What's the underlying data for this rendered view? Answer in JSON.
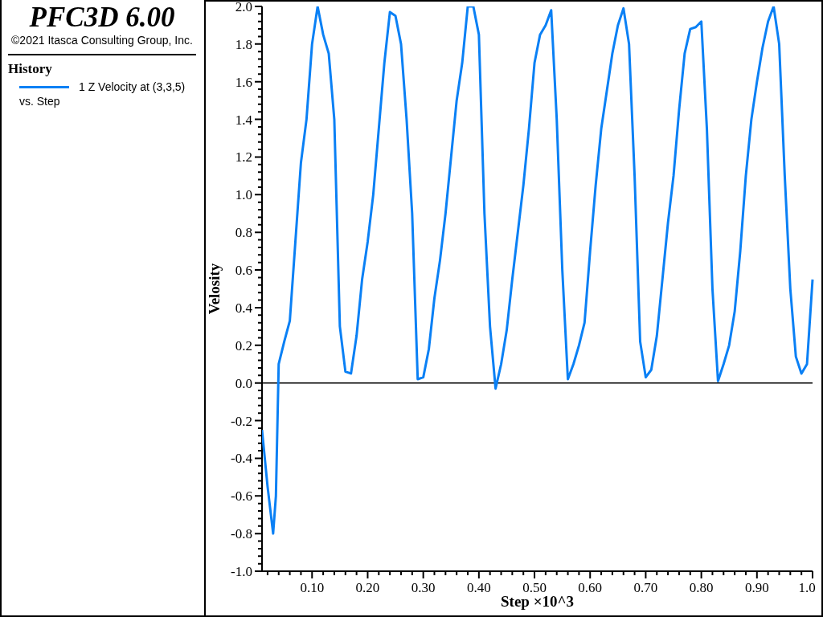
{
  "header": {
    "title": "PFC3D 6.00",
    "copyright": "©2021 Itasca Consulting Group, Inc."
  },
  "legend": {
    "heading": "History",
    "footer": "vs. Step"
  },
  "plot": {
    "chart_data": {
      "type": "line",
      "xlabel": "Step ×10^3",
      "ylabel": "Velosity",
      "xlim": [
        0.01,
        1.0
      ],
      "ylim": [
        -1.0,
        2.0
      ],
      "xticks": [
        {
          "value": 0.1,
          "label": "0.10"
        },
        {
          "value": 0.2,
          "label": "0.20"
        },
        {
          "value": 0.3,
          "label": "0.30"
        },
        {
          "value": 0.4,
          "label": "0.40"
        },
        {
          "value": 0.5,
          "label": "0.50"
        },
        {
          "value": 0.6,
          "label": "0.60"
        },
        {
          "value": 0.7,
          "label": "0.70"
        },
        {
          "value": 0.8,
          "label": "0.80"
        },
        {
          "value": 0.9,
          "label": "0.90"
        },
        {
          "value": 1.0,
          "label": "1.0"
        }
      ],
      "yticks": [
        {
          "value": -1.0,
          "label": "-1.0"
        },
        {
          "value": -0.8,
          "label": "-0.8"
        },
        {
          "value": -0.6,
          "label": "-0.6"
        },
        {
          "value": -0.4,
          "label": "-0.4"
        },
        {
          "value": -0.2,
          "label": "-0.2"
        },
        {
          "value": 0.0,
          "label": "0.0"
        },
        {
          "value": 0.2,
          "label": "0.2"
        },
        {
          "value": 0.4,
          "label": "0.4"
        },
        {
          "value": 0.6,
          "label": "0.6"
        },
        {
          "value": 0.8,
          "label": "0.8"
        },
        {
          "value": 1.0,
          "label": "1.0"
        },
        {
          "value": 1.2,
          "label": "1.2"
        },
        {
          "value": 1.4,
          "label": "1.4"
        },
        {
          "value": 1.6,
          "label": "1.6"
        },
        {
          "value": 1.8,
          "label": "1.8"
        },
        {
          "value": 2.0,
          "label": "2.0"
        }
      ],
      "x": [
        0.01,
        0.02,
        0.03,
        0.035,
        0.04,
        0.05,
        0.06,
        0.07,
        0.08,
        0.09,
        0.1,
        0.11,
        0.12,
        0.13,
        0.14,
        0.15,
        0.16,
        0.17,
        0.18,
        0.19,
        0.2,
        0.21,
        0.22,
        0.23,
        0.24,
        0.25,
        0.26,
        0.27,
        0.28,
        0.29,
        0.3,
        0.31,
        0.32,
        0.33,
        0.34,
        0.35,
        0.36,
        0.37,
        0.38,
        0.39,
        0.4,
        0.41,
        0.42,
        0.43,
        0.44,
        0.45,
        0.46,
        0.47,
        0.48,
        0.49,
        0.5,
        0.51,
        0.52,
        0.53,
        0.54,
        0.55,
        0.56,
        0.57,
        0.58,
        0.59,
        0.6,
        0.61,
        0.62,
        0.63,
        0.64,
        0.65,
        0.66,
        0.67,
        0.68,
        0.69,
        0.7,
        0.71,
        0.72,
        0.73,
        0.74,
        0.75,
        0.76,
        0.77,
        0.78,
        0.79,
        0.8,
        0.81,
        0.82,
        0.83,
        0.84,
        0.85,
        0.86,
        0.87,
        0.88,
        0.89,
        0.9,
        0.91,
        0.92,
        0.93,
        0.94,
        0.95,
        0.96,
        0.97,
        0.98,
        0.99,
        1.0
      ],
      "series": [
        {
          "name": "1 Z Velocity at (3,3,5)",
          "color": "#0a80f5",
          "values": [
            -0.25,
            -0.55,
            -0.8,
            -0.6,
            0.1,
            0.22,
            0.33,
            0.75,
            1.17,
            1.4,
            1.8,
            2.0,
            1.85,
            1.75,
            1.4,
            0.3,
            0.06,
            0.05,
            0.25,
            0.55,
            0.75,
            1.0,
            1.35,
            1.7,
            1.97,
            1.95,
            1.8,
            1.4,
            0.9,
            0.02,
            0.03,
            0.18,
            0.45,
            0.65,
            0.9,
            1.2,
            1.5,
            1.7,
            2.0,
            2.0,
            1.85,
            0.9,
            0.3,
            -0.03,
            0.1,
            0.28,
            0.55,
            0.8,
            1.05,
            1.35,
            1.7,
            1.85,
            1.9,
            1.98,
            1.4,
            0.6,
            0.02,
            0.1,
            0.2,
            0.32,
            0.7,
            1.05,
            1.35,
            1.55,
            1.75,
            1.9,
            1.99,
            1.8,
            1.1,
            0.22,
            0.03,
            0.07,
            0.25,
            0.55,
            0.85,
            1.1,
            1.45,
            1.75,
            1.88,
            1.89,
            1.92,
            1.35,
            0.5,
            0.01,
            0.1,
            0.2,
            0.38,
            0.7,
            1.1,
            1.4,
            1.6,
            1.78,
            1.92,
            2.0,
            1.8,
            1.1,
            0.5,
            0.14,
            0.05,
            0.1,
            0.55
          ]
        }
      ]
    }
  }
}
